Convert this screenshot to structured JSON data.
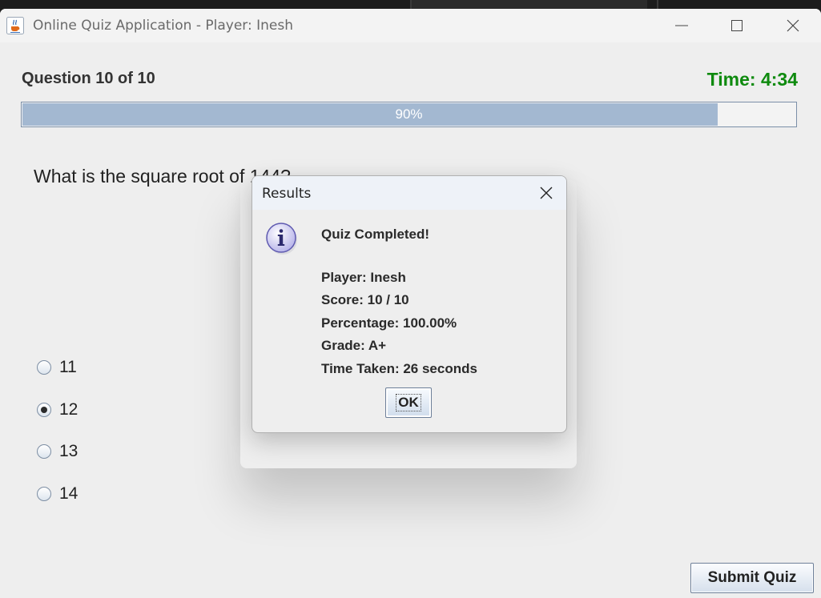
{
  "window": {
    "title": "Online Quiz Application - Player: Inesh"
  },
  "quiz": {
    "question_header": "Question 10 of 10",
    "timer": "Time: 4:34",
    "progress_label": "90%",
    "progress_fraction": 0.9,
    "question_text": "What is the square root of 144?",
    "options": [
      {
        "label": "11",
        "selected": false
      },
      {
        "label": "12",
        "selected": true
      },
      {
        "label": "13",
        "selected": false
      },
      {
        "label": "14",
        "selected": false
      }
    ],
    "submit_label": "Submit Quiz"
  },
  "dialog": {
    "title": "Results",
    "heading": "Quiz Completed!",
    "lines": [
      "Player: Inesh",
      "Score: 10 / 10",
      "Percentage: 100.00%",
      "Grade: A+",
      "Time Taken: 26 seconds"
    ],
    "ok_label": "OK"
  },
  "colors": {
    "timer": "#0e8a0e",
    "progress_fill": "#a3b8d1"
  },
  "icons": {
    "app": "java-cup-icon",
    "info": "info-icon",
    "minimize": "minimize-icon",
    "maximize": "maximize-icon",
    "close": "close-icon"
  }
}
